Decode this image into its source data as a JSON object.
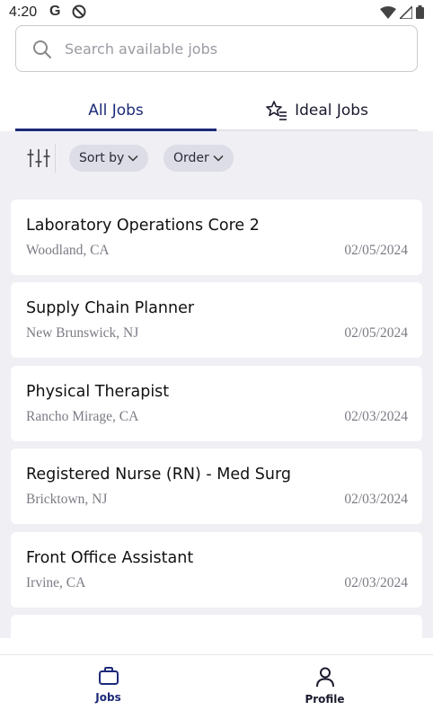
{
  "status_bar": {
    "time": "4:20",
    "google_glyph": "G"
  },
  "search": {
    "placeholder": "Search available jobs",
    "value": ""
  },
  "tabs": [
    {
      "label": "All Jobs",
      "active": true
    },
    {
      "label": "Ideal Jobs",
      "active": false,
      "icon": "star-list-icon"
    }
  ],
  "filters": {
    "sort_label": "Sort by",
    "order_label": "Order"
  },
  "jobs": [
    {
      "title": "Laboratory Operations Core 2",
      "location": "Woodland, CA",
      "date": "02/05/2024"
    },
    {
      "title": "Supply Chain Planner",
      "location": "New Brunswick, NJ",
      "date": "02/05/2024"
    },
    {
      "title": "Physical Therapist",
      "location": "Rancho Mirage, CA",
      "date": "02/03/2024"
    },
    {
      "title": "Registered Nurse (RN) - Med Surg",
      "location": "Bricktown, NJ",
      "date": "02/03/2024"
    },
    {
      "title": "Front Office Assistant",
      "location": "Irvine, CA",
      "date": "02/03/2024"
    }
  ],
  "bottom_nav": [
    {
      "label": "Jobs",
      "icon": "briefcase-icon",
      "active": true
    },
    {
      "label": "Profile",
      "icon": "person-icon",
      "active": false
    }
  ],
  "colors": {
    "accent": "#1c2a78",
    "content_bg": "#efeff4",
    "chip_bg": "#dcdde6",
    "muted_text": "#7b7b85"
  }
}
